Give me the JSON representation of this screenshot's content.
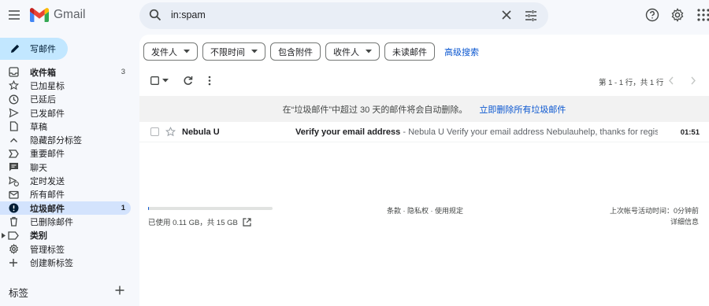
{
  "app": {
    "name": "Gmail",
    "colors": {
      "accent": "#0b57d0",
      "compose_bg": "#c2e7ff",
      "active_nav_bg": "#d3e3fd",
      "page_bg": "#f6f8fc"
    }
  },
  "search": {
    "value": "in:spam"
  },
  "compose": {
    "label": "写邮件"
  },
  "sidebar": {
    "items": [
      {
        "id": "inbox",
        "label": "收件箱",
        "icon": "inbox-icon",
        "count": "3",
        "bold": true
      },
      {
        "id": "starred",
        "label": "已加星标",
        "icon": "star-icon"
      },
      {
        "id": "snoozed",
        "label": "已延后",
        "icon": "clock-icon"
      },
      {
        "id": "sent",
        "label": "已发邮件",
        "icon": "send-icon"
      },
      {
        "id": "drafts",
        "label": "草稿",
        "icon": "draft-icon"
      },
      {
        "id": "less",
        "label": "隐藏部分标签",
        "icon": "chevron-up-icon"
      },
      {
        "id": "important",
        "label": "重要邮件",
        "icon": "important-icon"
      },
      {
        "id": "chats",
        "label": "聊天",
        "icon": "chat-icon"
      },
      {
        "id": "scheduled",
        "label": "定时发送",
        "icon": "scheduled-send-icon"
      },
      {
        "id": "all-mail",
        "label": "所有邮件",
        "icon": "all-mail-icon"
      },
      {
        "id": "spam",
        "label": "垃圾邮件",
        "icon": "spam-icon",
        "count": "1",
        "bold": true,
        "active": true
      },
      {
        "id": "trash",
        "label": "已删除邮件",
        "icon": "trash-icon"
      },
      {
        "id": "categories",
        "label": "类别",
        "icon": "label-icon",
        "bold": true
      },
      {
        "id": "manage-labels",
        "label": "管理标签",
        "icon": "gear-icon"
      },
      {
        "id": "create-label",
        "label": "创建新标签",
        "icon": "plus-icon"
      }
    ],
    "labels_title": "标签"
  },
  "filters": {
    "chips": [
      {
        "label": "发件人",
        "dropdown": true
      },
      {
        "label": "不限时间",
        "dropdown": true
      },
      {
        "label": "包含附件",
        "dropdown": false
      },
      {
        "label": "收件人",
        "dropdown": true
      },
      {
        "label": "未读邮件",
        "dropdown": false
      }
    ],
    "advanced_search": "高级搜索"
  },
  "toolbar": {
    "pager_text": "第 1 - 1 行，共 1 行"
  },
  "banner": {
    "text": "在“垃圾邮件”中超过 30 天的邮件将会自动删除。",
    "link": "立即删除所有垃圾邮件"
  },
  "emails": [
    {
      "sender": "Nebula U",
      "subject": "Verify your email address",
      "snippet": " - Nebula U Verify your email address Nebulauhelp, thanks for regist...",
      "time": "01:51"
    }
  ],
  "footer": {
    "storage_text": "已使用 0.11 GB，共 15 GB",
    "storage_fraction": 0.007,
    "links": "条款 · 隐私权 · 使用规定",
    "last_activity": "上次帐号活动时间：0分钟前",
    "details": "详细信息"
  }
}
